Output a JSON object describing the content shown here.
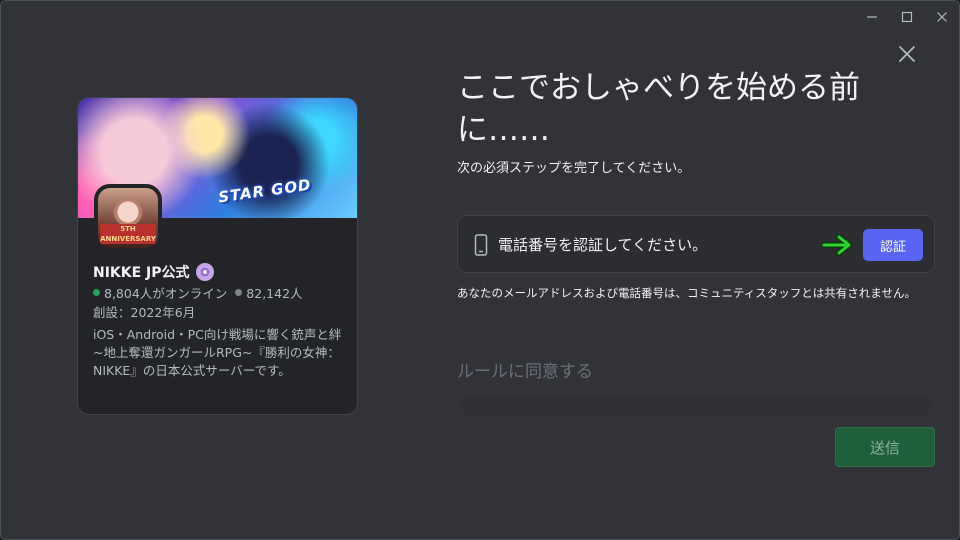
{
  "window_controls": {
    "minimize": "—",
    "maximize": "☐",
    "close": "✕"
  },
  "server": {
    "name": "NIKKE JP公式",
    "online": "8,804人がオンライン",
    "members": "82,142人",
    "created": "創設：2022年6月",
    "description": "iOS・Android・PC向け戦場に響く銃声と絆~地上奪還ガンガールRPG~『勝利の女神：NIKKE』の日本公式サーバーです。",
    "avatar_badge": "5TH ANNIVERSARY",
    "banner_logo": "STAR GOD"
  },
  "modal": {
    "title": "ここでおしゃべりを始める前に……",
    "subtitle": "次の必須ステップを完了してください。",
    "verify_text": "電話番号を認証してください。",
    "verify_button": "認証",
    "notice": "あなたのメールアドレスおよび電話番号は、コミュニティスタッフとは共有されません。",
    "rules_title": "ルールに同意する",
    "submit_button": "送信"
  },
  "colors": {
    "accent": "#5865f2",
    "online": "#23a55a",
    "arrow": "#2fd52f",
    "submit": "#1f5f3a"
  },
  "icons": [
    "minimize-icon",
    "maximize-icon",
    "window-close-icon",
    "modal-close-icon",
    "phone-icon",
    "arrow-right-icon",
    "partner-badge-icon"
  ]
}
